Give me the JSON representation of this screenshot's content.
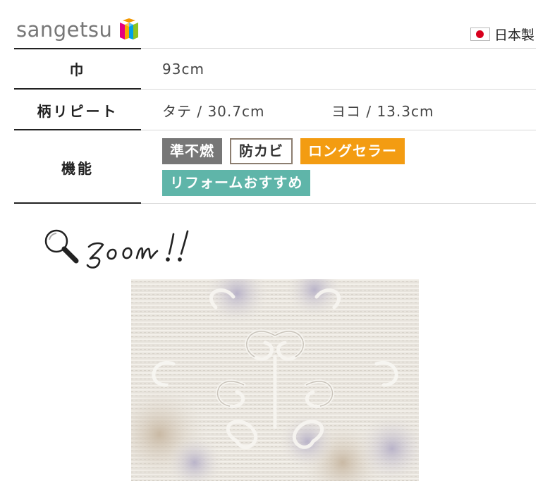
{
  "brand": {
    "name": "sangetsu",
    "logo_icon": "sangetsu-logo-icon"
  },
  "origin": {
    "label": "日本製",
    "flag_icon": "japan-flag-icon"
  },
  "spec": {
    "width": {
      "label": "巾",
      "value": "93cm"
    },
    "repeat": {
      "label": "柄リピート",
      "vertical": "タテ / 30.7cm",
      "horizontal": "ヨコ /  13.3cm"
    },
    "features": {
      "label": "機能",
      "tags": [
        {
          "text": "準不燃",
          "style": "gray",
          "color": "#777777"
        },
        {
          "text": "防カビ",
          "style": "outline",
          "color": "#8c7e70"
        },
        {
          "text": "ロングセラー",
          "style": "orange",
          "color": "#f39c12"
        },
        {
          "text": "リフォームおすすめ",
          "style": "teal",
          "color": "#5fb5a9"
        }
      ]
    }
  },
  "zoom": {
    "text": "zoom!!",
    "icon": "magnifier-icon"
  },
  "sample": {
    "icon": "fabric-texture-image"
  }
}
